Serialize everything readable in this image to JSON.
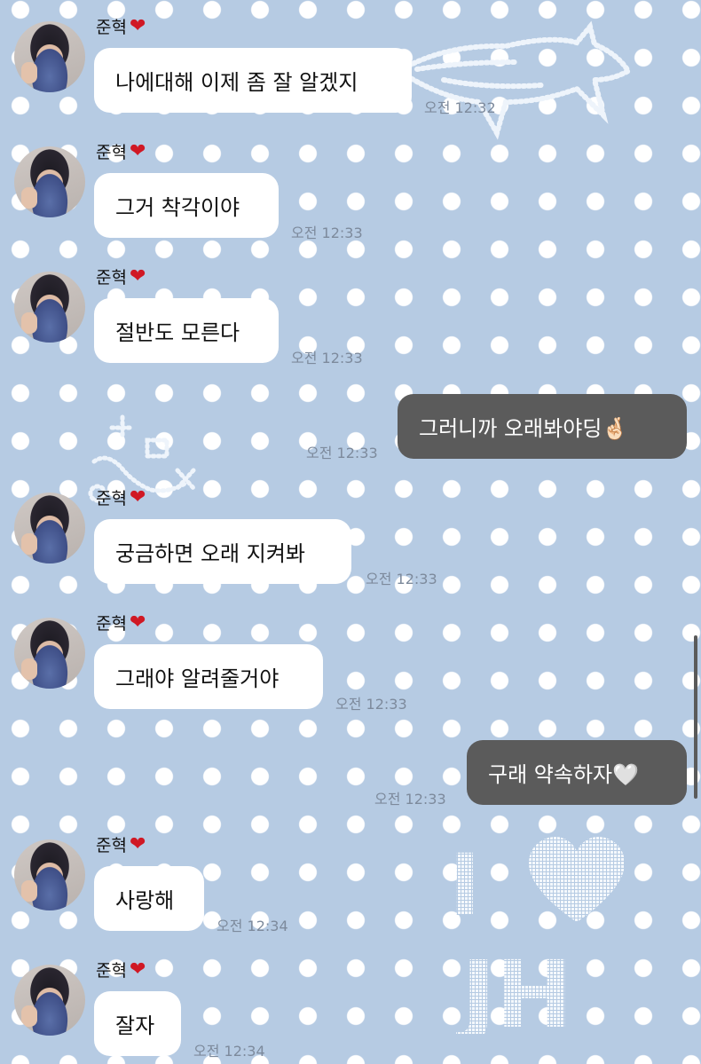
{
  "sender": {
    "name": "준혁",
    "badge": "❤"
  },
  "messages": [
    {
      "from": "other",
      "text": "나에대해 이제 좀 잘 알겠지",
      "time": "오전 12:32"
    },
    {
      "from": "other",
      "text": "그거 착각이야",
      "time": "오전 12:33"
    },
    {
      "from": "other",
      "text": "절반도 모른다",
      "time": "오전 12:33"
    },
    {
      "from": "me",
      "text": "그러니까 오래봐야딩🤞🏻",
      "time": "오전 12:33"
    },
    {
      "from": "other",
      "text": "궁금하면 오래 지켜봐",
      "time": "오전 12:33"
    },
    {
      "from": "other",
      "text": "그래야 알려줄거야",
      "time": "오전 12:33"
    },
    {
      "from": "me",
      "text": "구래 약속하자🤍",
      "time": "오전 12:33"
    },
    {
      "from": "other",
      "text": "사랑해",
      "time": "오전 12:34"
    },
    {
      "from": "other",
      "text": "잘자",
      "time": "오전 12:34"
    }
  ],
  "wallpaper": {
    "background": "#b6cbe3",
    "dots": "#ffffff",
    "decorations": [
      "whale-stitch",
      "small-stitch",
      "heart-stitch"
    ],
    "text": [
      "I",
      "JH"
    ]
  },
  "colors": {
    "my_bubble": "#5b5b5b",
    "their_bubble": "#ffffff",
    "heart": "#d01824"
  }
}
